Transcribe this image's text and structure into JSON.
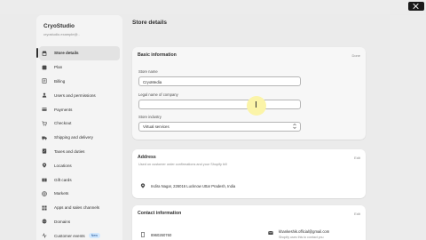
{
  "sidebar": {
    "store_name": "CryoStudio",
    "store_email": "cryostudio.example@..",
    "items": [
      {
        "label": "Store details",
        "icon": "store-icon",
        "active": true
      },
      {
        "label": "Plan",
        "icon": "plan-icon"
      },
      {
        "label": "Billing",
        "icon": "billing-icon"
      },
      {
        "label": "Users and permissions",
        "icon": "users-icon"
      },
      {
        "label": "Payments",
        "icon": "payments-icon"
      },
      {
        "label": "Checkout",
        "icon": "checkout-icon"
      },
      {
        "label": "Shipping and delivery",
        "icon": "shipping-icon"
      },
      {
        "label": "Taxes and duties",
        "icon": "taxes-icon"
      },
      {
        "label": "Locations",
        "icon": "location-icon"
      },
      {
        "label": "Gift cards",
        "icon": "gift-card-icon"
      },
      {
        "label": "Markets",
        "icon": "markets-icon"
      },
      {
        "label": "Apps and sales channels",
        "icon": "apps-icon"
      },
      {
        "label": "Domains",
        "icon": "domains-icon"
      },
      {
        "label": "Customer events",
        "icon": "customer-events-icon",
        "badge": "New"
      }
    ]
  },
  "main": {
    "title": "Store details",
    "basic": {
      "title": "Basic information",
      "edit": "Done",
      "store_name_label": "Store name",
      "store_name_value": "CryoMedia",
      "legal_label": "Legal name of company",
      "legal_value": "",
      "industry_label": "Store industry",
      "industry_value": "Virtual services"
    },
    "address": {
      "title": "Address",
      "edit": "Edit",
      "description": "Used on customer order confirmations and your Shopify bill",
      "value": "Indira Nagar, 226016 Lucknow Uttar Pradesh, India"
    },
    "contact": {
      "title": "Contact information",
      "edit": "Edit",
      "phone": "8960260760",
      "email": "khankeshik.official@gmail.com",
      "email_note": "Shopify uses this to contact you"
    }
  }
}
